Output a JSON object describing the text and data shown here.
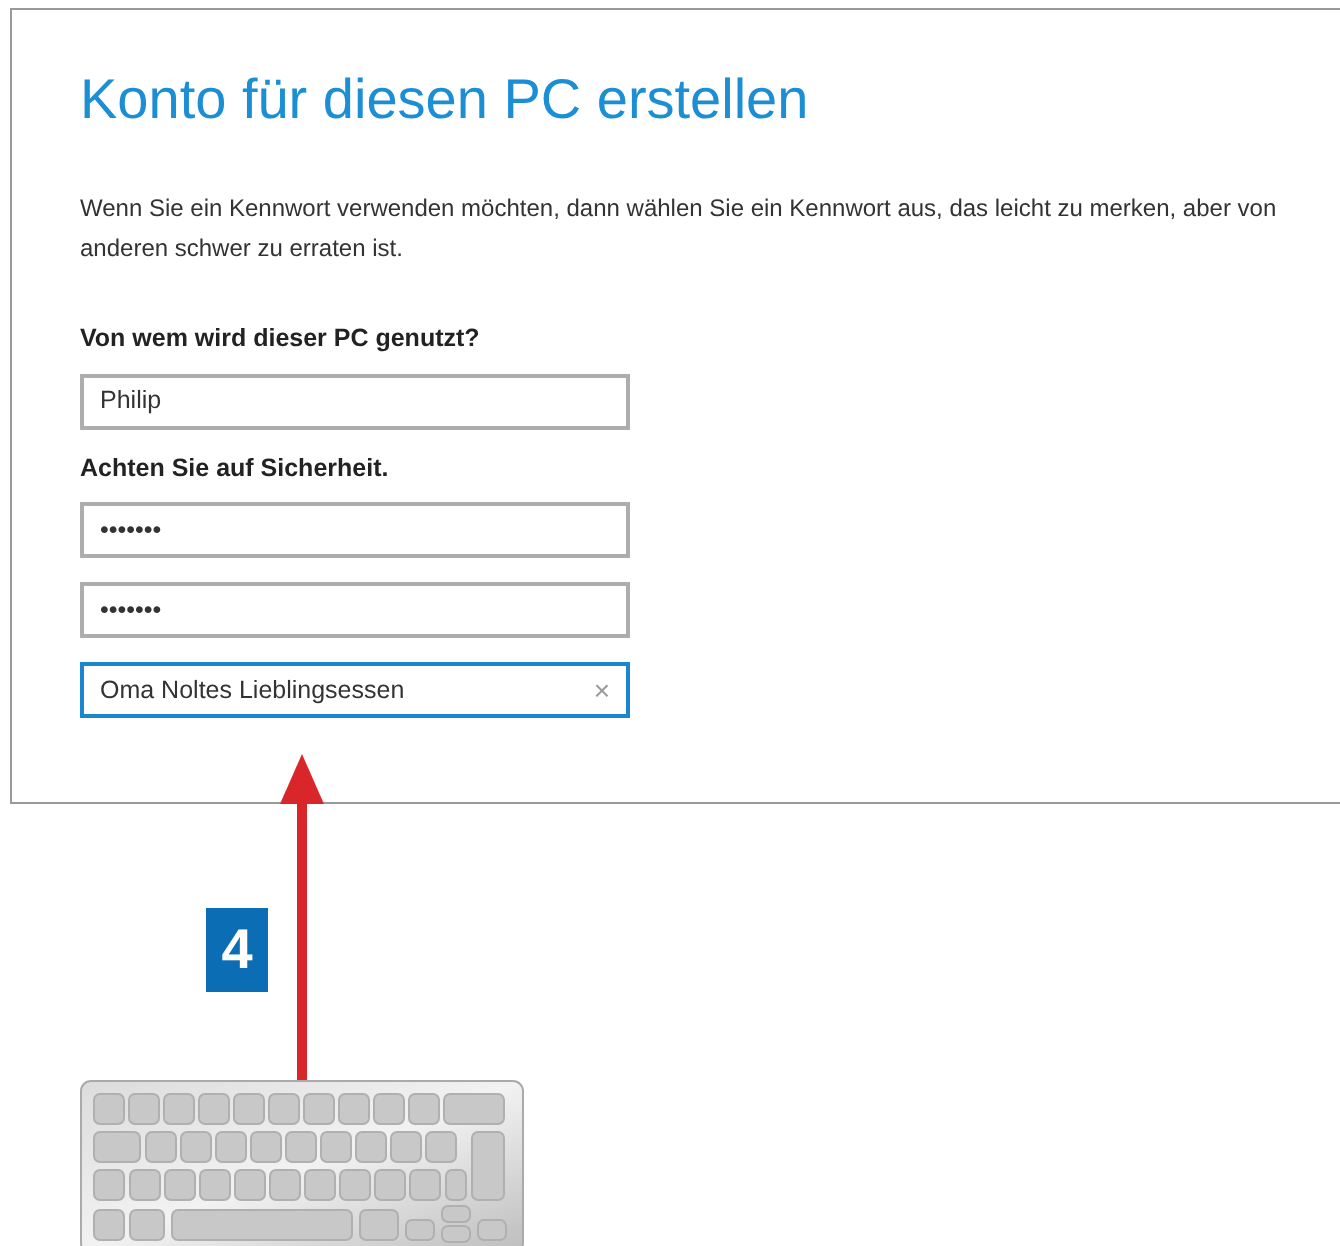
{
  "title": "Konto für diesen PC erstellen",
  "intro": "Wenn Sie ein Kennwort verwenden möchten, dann wählen Sie ein Kennwort aus, das leicht zu merken, aber von anderen schwer zu erraten ist.",
  "sections": [
    {
      "label": "Von wem wird dieser PC genutzt?",
      "fields": [
        {
          "value": "Philip",
          "focused": false
        }
      ]
    },
    {
      "label": "Achten Sie auf Sicherheit.",
      "fields": [
        {
          "value": "•••••••",
          "focused": false
        },
        {
          "value": "•••••••",
          "focused": false
        },
        {
          "value": "Oma Noltes Lieblingsessen",
          "focused": true,
          "clear": "×"
        }
      ]
    }
  ],
  "step_badge": "4"
}
